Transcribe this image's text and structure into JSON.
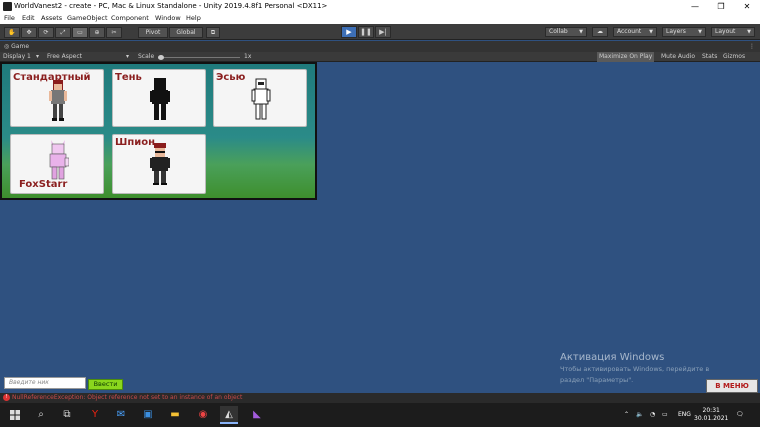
{
  "window": {
    "title": "WorldVanest2 - create - PC, Mac & Linux Standalone - Unity 2019.4.8f1 Personal <DX11>",
    "minimize": "—",
    "maximize": "❐",
    "close": "✕"
  },
  "menu": [
    "File",
    "Edit",
    "Assets",
    "GameObject",
    "Component",
    "Window",
    "Help"
  ],
  "toolbar": {
    "pivot": "Pivot",
    "global": "Global",
    "collab": "Collab",
    "account": "Account",
    "layers": "Layers",
    "layout": "Layout"
  },
  "game_tab": {
    "label": "Game",
    "display": "Display 1",
    "aspect": "Free Aspect",
    "scale_label": "Scale",
    "scale_value": "1x",
    "maximize_on_play": "Maximize On Play",
    "mute_audio": "Mute Audio",
    "stats": "Stats",
    "gizmos": "Gizmos"
  },
  "skins": [
    {
      "label": "Стандартный"
    },
    {
      "label": "Тень"
    },
    {
      "label": "Эсью"
    },
    {
      "label": "FoxStarr"
    },
    {
      "label": "Шпион"
    }
  ],
  "name_input": {
    "placeholder": "Введите ник"
  },
  "enter_button": "Ввести",
  "activation": {
    "title": "Активация Windows",
    "line1": "Чтобы активировать Windows, перейдите в",
    "line2": "раздел \"Параметры\"."
  },
  "menu_button": "В МЕНЮ",
  "status_error": "NullReferenceException: Object reference not set to an instance of an object",
  "taskbar": {
    "lang": "ENG",
    "time": "20:31",
    "date": "30.01.2021"
  }
}
